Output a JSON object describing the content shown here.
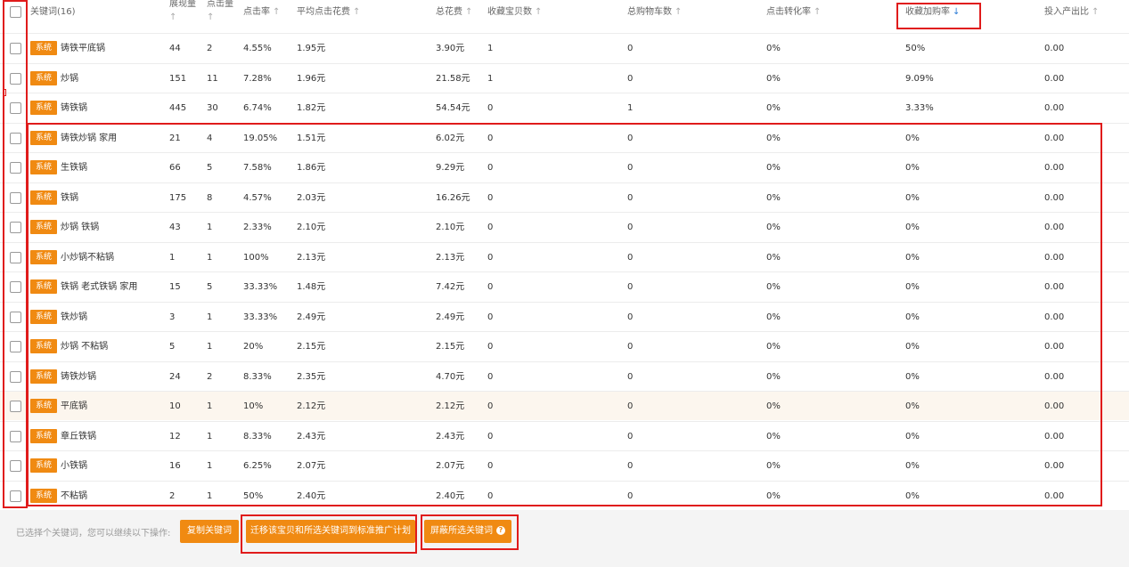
{
  "header": {
    "keyword": "关键词(16)",
    "impressions": "展现量",
    "clicks": "点击量",
    "ctr": "点击率",
    "avg_cpc": "平均点击花费",
    "total_cost": "总花费",
    "fav_items": "收藏宝贝数",
    "cart": "总购物车数",
    "conv_rate": "点击转化率",
    "fav_cart_rate": "收藏加购率",
    "roi": "投入产出比",
    "arrow_up": "↑",
    "arrow_down": "↓"
  },
  "rows": [
    {
      "tag": "系统",
      "keyword": "铸铁平底锅",
      "impressions": "44",
      "clicks": "2",
      "ctr": "4.55%",
      "avg_cpc": "1.95元",
      "cost": "3.90元",
      "fav": "1",
      "cart": "0",
      "conv": "0%",
      "favcart": "50%",
      "roi": "0.00"
    },
    {
      "tag": "系统",
      "keyword": "炒锅",
      "impressions": "151",
      "clicks": "11",
      "ctr": "7.28%",
      "avg_cpc": "1.96元",
      "cost": "21.58元",
      "fav": "1",
      "cart": "0",
      "conv": "0%",
      "favcart": "9.09%",
      "roi": "0.00"
    },
    {
      "tag": "系统",
      "keyword": "铸铁锅",
      "impressions": "445",
      "clicks": "30",
      "ctr": "6.74%",
      "avg_cpc": "1.82元",
      "cost": "54.54元",
      "fav": "0",
      "cart": "1",
      "conv": "0%",
      "favcart": "3.33%",
      "roi": "0.00"
    },
    {
      "tag": "系统",
      "keyword": "铸铁炒锅 家用",
      "impressions": "21",
      "clicks": "4",
      "ctr": "19.05%",
      "avg_cpc": "1.51元",
      "cost": "6.02元",
      "fav": "0",
      "cart": "0",
      "conv": "0%",
      "favcart": "0%",
      "roi": "0.00"
    },
    {
      "tag": "系统",
      "keyword": "生铁锅",
      "impressions": "66",
      "clicks": "5",
      "ctr": "7.58%",
      "avg_cpc": "1.86元",
      "cost": "9.29元",
      "fav": "0",
      "cart": "0",
      "conv": "0%",
      "favcart": "0%",
      "roi": "0.00"
    },
    {
      "tag": "系统",
      "keyword": "铁锅",
      "impressions": "175",
      "clicks": "8",
      "ctr": "4.57%",
      "avg_cpc": "2.03元",
      "cost": "16.26元",
      "fav": "0",
      "cart": "0",
      "conv": "0%",
      "favcart": "0%",
      "roi": "0.00"
    },
    {
      "tag": "系统",
      "keyword": "炒锅 铁锅",
      "impressions": "43",
      "clicks": "1",
      "ctr": "2.33%",
      "avg_cpc": "2.10元",
      "cost": "2.10元",
      "fav": "0",
      "cart": "0",
      "conv": "0%",
      "favcart": "0%",
      "roi": "0.00"
    },
    {
      "tag": "系统",
      "keyword": "小炒锅不粘锅",
      "impressions": "1",
      "clicks": "1",
      "ctr": "100%",
      "avg_cpc": "2.13元",
      "cost": "2.13元",
      "fav": "0",
      "cart": "0",
      "conv": "0%",
      "favcart": "0%",
      "roi": "0.00"
    },
    {
      "tag": "系统",
      "keyword": "铁锅 老式铁锅 家用",
      "impressions": "15",
      "clicks": "5",
      "ctr": "33.33%",
      "avg_cpc": "1.48元",
      "cost": "7.42元",
      "fav": "0",
      "cart": "0",
      "conv": "0%",
      "favcart": "0%",
      "roi": "0.00"
    },
    {
      "tag": "系统",
      "keyword": "铁炒锅",
      "impressions": "3",
      "clicks": "1",
      "ctr": "33.33%",
      "avg_cpc": "2.49元",
      "cost": "2.49元",
      "fav": "0",
      "cart": "0",
      "conv": "0%",
      "favcart": "0%",
      "roi": "0.00"
    },
    {
      "tag": "系统",
      "keyword": "炒锅 不粘锅",
      "impressions": "5",
      "clicks": "1",
      "ctr": "20%",
      "avg_cpc": "2.15元",
      "cost": "2.15元",
      "fav": "0",
      "cart": "0",
      "conv": "0%",
      "favcart": "0%",
      "roi": "0.00"
    },
    {
      "tag": "系统",
      "keyword": "铸铁炒锅",
      "impressions": "24",
      "clicks": "2",
      "ctr": "8.33%",
      "avg_cpc": "2.35元",
      "cost": "4.70元",
      "fav": "0",
      "cart": "0",
      "conv": "0%",
      "favcart": "0%",
      "roi": "0.00"
    },
    {
      "tag": "系统",
      "keyword": "平底锅",
      "impressions": "10",
      "clicks": "1",
      "ctr": "10%",
      "avg_cpc": "2.12元",
      "cost": "2.12元",
      "fav": "0",
      "cart": "0",
      "conv": "0%",
      "favcart": "0%",
      "roi": "0.00"
    },
    {
      "tag": "系统",
      "keyword": "章丘铁锅",
      "impressions": "12",
      "clicks": "1",
      "ctr": "8.33%",
      "avg_cpc": "2.43元",
      "cost": "2.43元",
      "fav": "0",
      "cart": "0",
      "conv": "0%",
      "favcart": "0%",
      "roi": "0.00"
    },
    {
      "tag": "系统",
      "keyword": "小铁锅",
      "impressions": "16",
      "clicks": "1",
      "ctr": "6.25%",
      "avg_cpc": "2.07元",
      "cost": "2.07元",
      "fav": "0",
      "cart": "0",
      "conv": "0%",
      "favcart": "0%",
      "roi": "0.00"
    },
    {
      "tag": "系统",
      "keyword": "不粘锅",
      "impressions": "2",
      "clicks": "1",
      "ctr": "50%",
      "avg_cpc": "2.40元",
      "cost": "2.40元",
      "fav": "0",
      "cart": "0",
      "conv": "0%",
      "favcart": "0%",
      "roi": "0.00"
    }
  ],
  "footer": {
    "text": "已选择个关键词，您可以继续以下操作:",
    "copy_btn": "复制关键词",
    "migrate_btn": "迁移该宝贝和所选关键词到标准推广计划",
    "block_btn": "屏蔽所选关键词",
    "help": "?"
  },
  "colors": {
    "accent": "#f08a12",
    "annotation": "#e01b1b",
    "sort_active": "#2b7bd6"
  }
}
